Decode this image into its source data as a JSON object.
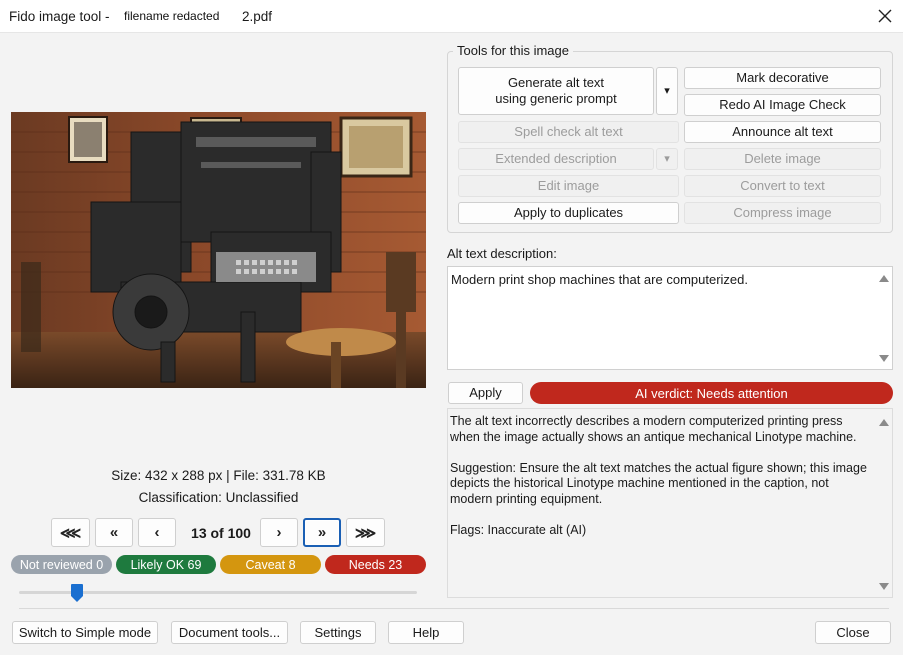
{
  "window": {
    "app_title": "Fido image tool -",
    "redacted_label": "filename redacted",
    "file_suffix": "2.pdf",
    "close_glyph": "✕"
  },
  "image_info": {
    "size_line": "Size: 432 x 288 px  |  File: 331.78 KB",
    "classification_line": "Classification: Unclassified"
  },
  "nav": {
    "first": "⋘",
    "prev_jump": "«",
    "prev": "‹",
    "counter": "13 of 100",
    "next": "›",
    "next_jump": "»",
    "last": "⋙"
  },
  "status_pills": {
    "not_reviewed": "Not reviewed 0",
    "likely_ok": "Likely OK 69",
    "caveat": "Caveat 8",
    "needs": "Needs 23"
  },
  "slider": {
    "position_fraction": 0.13
  },
  "tools": {
    "legend": "Tools for this image",
    "generate_line1": "Generate alt text",
    "generate_line2": "using generic prompt",
    "dropdown_glyph": "▾",
    "mark_decorative": "Mark decorative",
    "redo_ai_check": "Redo AI Image Check",
    "spell_check": "Spell check alt text",
    "announce": "Announce alt text",
    "extended_description": "Extended description",
    "delete_image": "Delete image",
    "edit_image": "Edit image",
    "convert_to_text": "Convert to text",
    "apply_to_duplicates": "Apply to duplicates",
    "compress_image": "Compress image"
  },
  "alt_text": {
    "label": "Alt text description:",
    "value": "Modern print shop machines that are computerized."
  },
  "apply_label": "Apply",
  "verdict": "AI verdict: Needs attention",
  "feedback": {
    "paragraph1": "The alt text incorrectly describes a modern computerized printing press when the image actually shows an antique mechanical Linotype machine.",
    "paragraph2": "Suggestion: Ensure the alt text matches the actual figure shown; this image depicts the historical Linotype machine mentioned in the caption, not modern printing equipment.",
    "paragraph3": "Flags: Inaccurate alt (AI)"
  },
  "footer": {
    "simple_mode": "Switch to Simple mode",
    "document_tools": "Document tools...",
    "settings": "Settings",
    "help": "Help",
    "close": "Close"
  },
  "colors": {
    "not_reviewed": "#9aa3ad",
    "likely_ok": "#1e7a3e",
    "caveat": "#d4960f",
    "needs": "#c0281d",
    "verdict": "#c0281d",
    "focus": "#1a5fb4"
  }
}
